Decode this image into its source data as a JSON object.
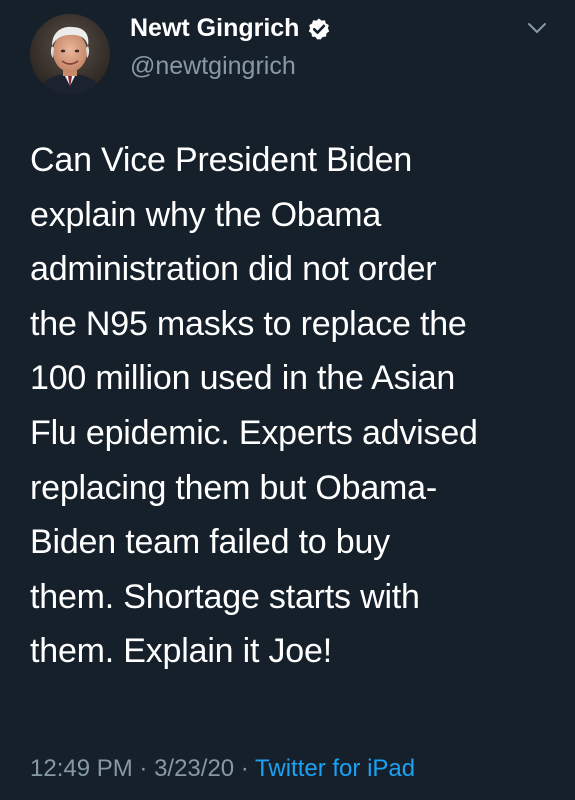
{
  "tweet": {
    "author": {
      "display_name": "Newt Gingrich",
      "handle": "@newtgingrich",
      "verified": true
    },
    "text": "Can Vice President Biden\nexplain why the Obama\nadministration did not order\nthe N95 masks to replace the\n100 million used in the Asian\nFlu epidemic. Experts advised\nreplacing them but Obama-\nBiden team failed to buy\nthem. Shortage starts with\nthem. Explain it Joe!",
    "meta": {
      "time": "12:49 PM",
      "separator_1": " · ",
      "date": "3/23/20",
      "separator_2": " · ",
      "source": "Twitter for iPad"
    }
  },
  "colors": {
    "background": "#15202b",
    "text_primary": "#ffffff",
    "text_secondary": "#8899a6",
    "accent": "#1da1f2"
  },
  "icons": {
    "verified": "verified-badge-icon",
    "more": "chevron-down-icon"
  }
}
